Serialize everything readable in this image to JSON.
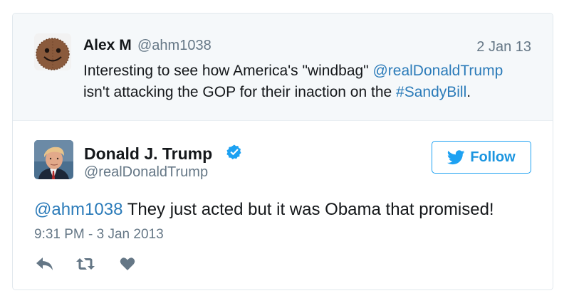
{
  "context_tweet": {
    "name": "Alex M",
    "handle": "@ahm1038",
    "date": "2 Jan 13",
    "text_part1": "Interesting to see how America's \"windbag\" ",
    "mention": "@realDonaldTrump",
    "text_part2": "isn't attacking the GOP for their inaction on the ",
    "hashtag": "#SandyBill",
    "text_part3": "."
  },
  "main_tweet": {
    "name": "Donald J. Trump",
    "handle": "@realDonaldTrump",
    "follow_label": "Follow",
    "mention": "@ahm1038",
    "text": " They just acted but it was Obama that promised!",
    "timestamp": "9:31 PM - 3 Jan 2013"
  },
  "icons": {
    "verified": "verified-badge-icon",
    "bird": "twitter-bird-icon",
    "reply": "reply-icon",
    "retweet": "retweet-icon",
    "like": "heart-icon"
  },
  "colors": {
    "link": "#2b7bb9",
    "brand": "#1da1f2",
    "muted": "#657786",
    "context_bg": "#f5f8fa"
  }
}
